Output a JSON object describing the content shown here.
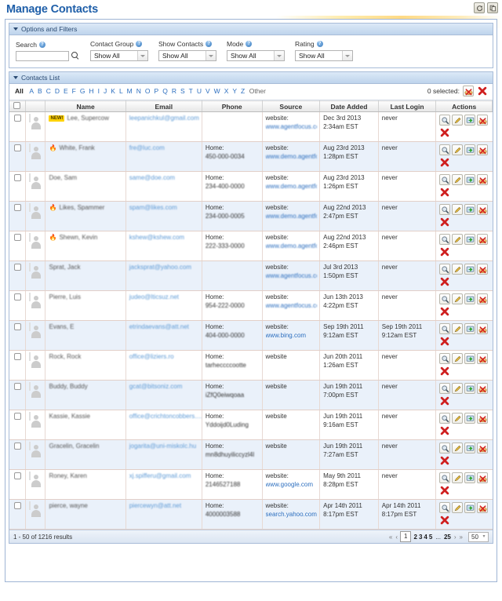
{
  "page": {
    "title": "Manage Contacts",
    "title_actions": [
      {
        "name": "refresh-icon",
        "glyph": "↺"
      },
      {
        "name": "copy-icon",
        "glyph": "❐"
      }
    ]
  },
  "options_panel": {
    "header": "Options and Filters",
    "search": {
      "label": "Search",
      "value": "",
      "placeholder": "",
      "help": "?"
    },
    "selects": [
      {
        "label": "Contact Group",
        "value": "Show All"
      },
      {
        "label": "Show Contacts",
        "value": "Show All"
      },
      {
        "label": "Mode",
        "value": "Show All"
      },
      {
        "label": "Rating",
        "value": "Show All"
      }
    ]
  },
  "contacts_panel": {
    "header": "Contacts List",
    "alphabet": {
      "all": "All",
      "letters": [
        "A",
        "B",
        "C",
        "D",
        "E",
        "F",
        "G",
        "H",
        "I",
        "J",
        "K",
        "L",
        "M",
        "N",
        "O",
        "P",
        "Q",
        "R",
        "S",
        "T",
        "U",
        "V",
        "W",
        "X",
        "Y",
        "Z"
      ],
      "other": "Other"
    },
    "selection": {
      "text": "0 selected:",
      "actions": [
        {
          "name": "bulk-spam-icon"
        },
        {
          "name": "bulk-delete-icon"
        }
      ]
    },
    "columns": [
      "",
      "",
      "Name",
      "Email",
      "Phone",
      "Source",
      "Date Added",
      "Last Login",
      "Actions"
    ],
    "row_actions": [
      {
        "name": "view-icon"
      },
      {
        "name": "edit-icon"
      },
      {
        "name": "login-as-icon"
      },
      {
        "name": "mark-spam-icon"
      },
      {
        "name": "delete-icon"
      }
    ],
    "rows": [
      {
        "badge": "NEW!",
        "flame": false,
        "name": "Lee, Supercow",
        "email": "leepanichkul@gmail.com",
        "phone_label": "",
        "phone_value": "",
        "source_label": "website:",
        "source_link": "www.agentfocus.com",
        "source_blurred": true,
        "date_added_1": "Dec 3rd 2013",
        "date_added_2": "2:34am EST",
        "last_login": "never",
        "last_login_2": ""
      },
      {
        "badge": "",
        "flame": true,
        "name": "White, Frank",
        "email": "fre@luc.com",
        "phone_label": "Home:",
        "phone_value": "450-000-0034",
        "source_label": "website:",
        "source_link": "www.demo.agentfocus ...",
        "source_blurred": true,
        "date_added_1": "Aug 23rd 2013",
        "date_added_2": "1:28pm EST",
        "last_login": "never",
        "last_login_2": ""
      },
      {
        "badge": "",
        "flame": false,
        "name": "Doe, Sam",
        "email": "same@doe.com",
        "phone_label": "Home:",
        "phone_value": "234-400-0000",
        "source_label": "website:",
        "source_link": "www.demo.agentfocus ...",
        "source_blurred": true,
        "date_added_1": "Aug 23rd 2013",
        "date_added_2": "1:26pm EST",
        "last_login": "never",
        "last_login_2": ""
      },
      {
        "badge": "",
        "flame": true,
        "name": "Likes, Spammer",
        "email": "spam@likes.com",
        "phone_label": "Home:",
        "phone_value": "234-000-0005",
        "source_label": "website:",
        "source_link": "www.demo.agentfocus ...",
        "source_blurred": true,
        "date_added_1": "Aug 22nd 2013",
        "date_added_2": "2:47pm EST",
        "last_login": "never",
        "last_login_2": ""
      },
      {
        "badge": "",
        "flame": true,
        "name": "Shewn, Kevin",
        "email": "kshew@kshew.com",
        "phone_label": "Home:",
        "phone_value": "222-333-0000",
        "source_label": "website:",
        "source_link": "www.demo.agentfocus ...",
        "source_blurred": true,
        "date_added_1": "Aug 22nd 2013",
        "date_added_2": "2:46pm EST",
        "last_login": "never",
        "last_login_2": ""
      },
      {
        "badge": "",
        "flame": false,
        "name": "Sprat, Jack",
        "email": "jacksprat@yahoo.com",
        "phone_label": "",
        "phone_value": "",
        "source_label": "website:",
        "source_link": "www.agentfocus.com",
        "source_blurred": true,
        "date_added_1": "Jul 3rd 2013",
        "date_added_2": "1:50pm EST",
        "last_login": "never",
        "last_login_2": ""
      },
      {
        "badge": "",
        "flame": false,
        "name": "Pierre, Luis",
        "email": "judeo@lticsuz.net",
        "phone_label": "Home:",
        "phone_value": "954-222-0000",
        "source_label": "website:",
        "source_link": "www.agentfocus.com",
        "source_blurred": true,
        "date_added_1": "Jun 13th 2013",
        "date_added_2": "4:22pm EST",
        "last_login": "never",
        "last_login_2": ""
      },
      {
        "badge": "",
        "flame": false,
        "name": "Evans, E",
        "email": "etrindaevans@att.net",
        "phone_label": "Home:",
        "phone_value": "404-000-0000",
        "source_label": "website:",
        "source_link": "www.bing.com",
        "source_blurred": false,
        "date_added_1": "Sep 19th 2011",
        "date_added_2": "9:12am EST",
        "last_login": "Sep 19th 2011",
        "last_login_2": "9:12am EST"
      },
      {
        "badge": "",
        "flame": false,
        "name": "Rock, Rock",
        "email": "office@liziers.ro",
        "phone_label": "Home:",
        "phone_value": "tarheccccootte",
        "source_label": "website",
        "source_link": "",
        "source_blurred": false,
        "date_added_1": "Jun 20th 2011",
        "date_added_2": "1:26am EST",
        "last_login": "never",
        "last_login_2": ""
      },
      {
        "badge": "",
        "flame": false,
        "name": "Buddy, Buddy",
        "email": "gcat@bitsoniz.com",
        "phone_label": "Home:",
        "phone_value": "iZfQ0eiwqoaa",
        "source_label": "website",
        "source_link": "",
        "source_blurred": false,
        "date_added_1": "Jun 19th 2011",
        "date_added_2": "7:00pm EST",
        "last_login": "never",
        "last_login_2": ""
      },
      {
        "badge": "",
        "flame": false,
        "name": "Kassie, Kassie",
        "email": "office@crichtoncobbers....",
        "phone_label": "Home:",
        "phone_value": "Yddoijd0Luding",
        "source_label": "website",
        "source_link": "",
        "source_blurred": false,
        "date_added_1": "Jun 19th 2011",
        "date_added_2": "9:16am EST",
        "last_login": "never",
        "last_login_2": ""
      },
      {
        "badge": "",
        "flame": false,
        "name": "Gracelin, Gracelin",
        "email": "jogarita@uni-miskolc.hu",
        "phone_label": "Home:",
        "phone_value": "mn8dhuyiliccyzl4l",
        "source_label": "website",
        "source_link": "",
        "source_blurred": false,
        "date_added_1": "Jun 19th 2011",
        "date_added_2": "7:27am EST",
        "last_login": "never",
        "last_login_2": ""
      },
      {
        "badge": "",
        "flame": false,
        "name": "Roney, Karen",
        "email": "xj.spifferu@gmail.com",
        "phone_label": "Home:",
        "phone_value": "2146527188",
        "source_label": "website:",
        "source_link": "www.google.com",
        "source_blurred": false,
        "date_added_1": "May 9th 2011",
        "date_added_2": "8:28pm EST",
        "last_login": "never",
        "last_login_2": ""
      },
      {
        "badge": "",
        "flame": false,
        "name": "pierce, wayne",
        "email": "piercewyn@att.net",
        "phone_label": "Home:",
        "phone_value": "4000003588",
        "source_label": "website:",
        "source_link": "search.yahoo.com",
        "source_blurred": false,
        "date_added_1": "Apr 14th 2011",
        "date_added_2": "8:17pm EST",
        "last_login": "Apr 14th 2011",
        "last_login_2": "8:17pm EST"
      }
    ]
  },
  "footer": {
    "results": "1 - 50 of 1216 results",
    "pager": {
      "first": "«",
      "prev": "‹",
      "current": "1",
      "pages": [
        "2",
        "3",
        "4",
        "5"
      ],
      "ellipsis": "...",
      "last_page": "25",
      "next": "›",
      "last": "»",
      "per_page": "50"
    }
  },
  "colors": {
    "title": "#1F5FA9",
    "link": "#2D6FBF",
    "badge": "#FFD200",
    "alt_row": "#EAF1FA"
  }
}
